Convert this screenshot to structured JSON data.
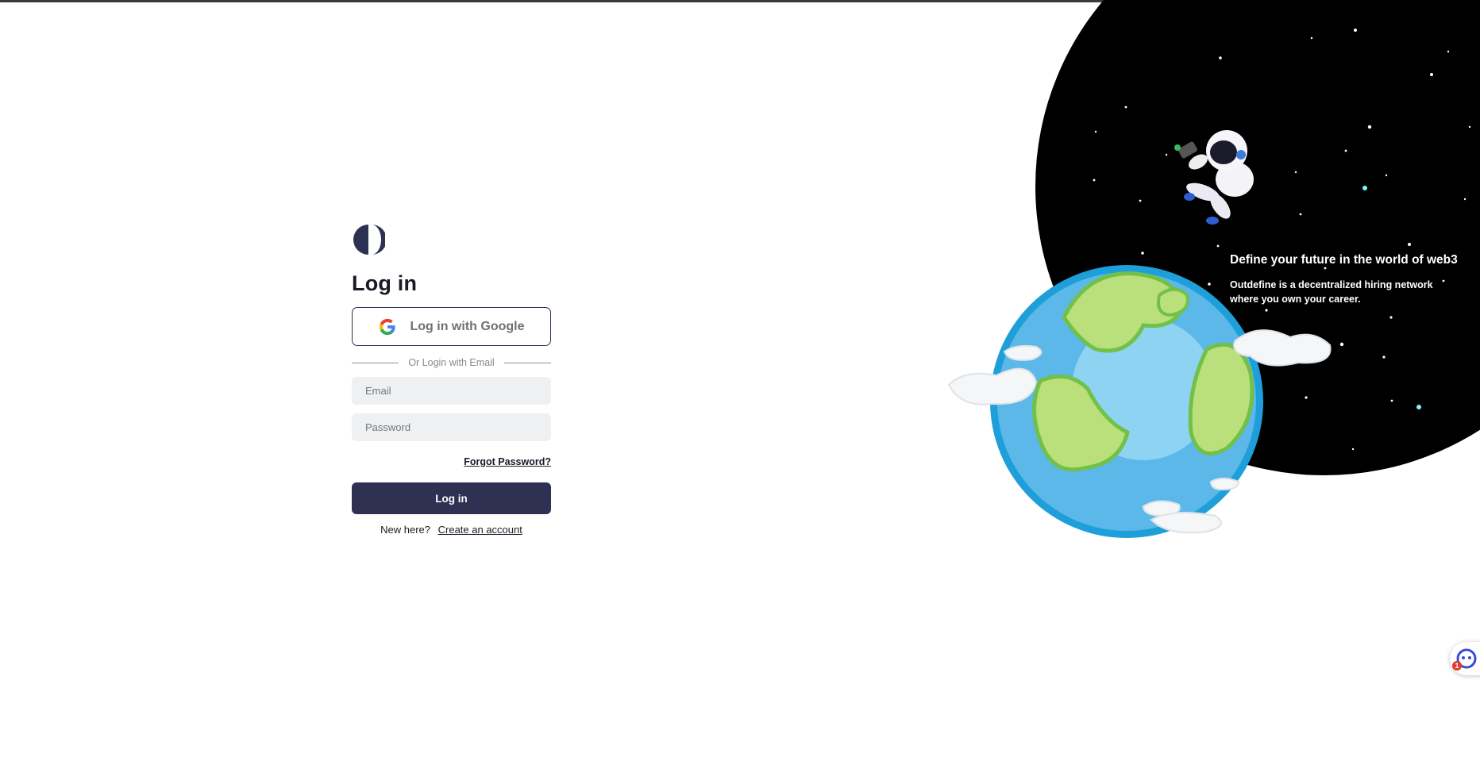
{
  "login": {
    "title": "Log in",
    "google_label": "Log in with Google",
    "divider_text": "Or Login with Email",
    "email_placeholder": "Email",
    "password_placeholder": "Password",
    "forgot_label": "Forgot Password?",
    "submit_label": "Log in",
    "signup_prompt": "New here?",
    "signup_link": "Create an account"
  },
  "hero": {
    "title": "Define your future in the world of web3",
    "subtitle": "Outdefine is a decentralized hiring network where you own your career."
  },
  "chat": {
    "badge_count": "1"
  },
  "colors": {
    "primary": "#2e3151",
    "space": "#000000",
    "input_bg": "#eff0f2",
    "ocean": "#5bb8e8",
    "land": "#b9e07a"
  },
  "icons": [
    "outdefine-logo-icon",
    "google-icon",
    "chat-support-icon"
  ]
}
